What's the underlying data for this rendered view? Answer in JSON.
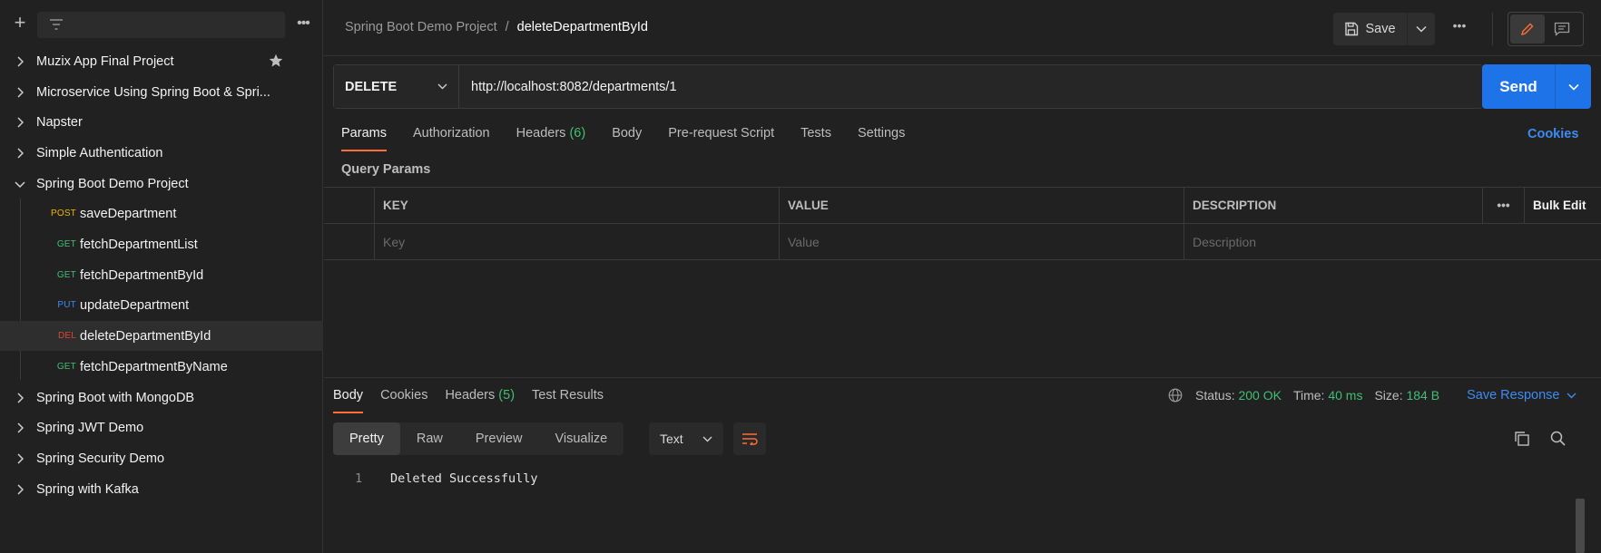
{
  "sidebar": {
    "collections": [
      {
        "label": "Muzix App Final Project",
        "expanded": false,
        "starred": true
      },
      {
        "label": "Microservice Using Spring Boot & Spri...",
        "expanded": false
      },
      {
        "label": "Napster",
        "expanded": false
      },
      {
        "label": "Simple Authentication",
        "expanded": false
      },
      {
        "label": "Spring Boot Demo Project",
        "expanded": true
      }
    ],
    "requests": [
      {
        "method": "POST",
        "name": "saveDepartment"
      },
      {
        "method": "GET",
        "name": "fetchDepartmentList"
      },
      {
        "method": "GET",
        "name": "fetchDepartmentById"
      },
      {
        "method": "PUT",
        "name": "updateDepartment"
      },
      {
        "method": "DEL",
        "name": "deleteDepartmentById",
        "selected": true
      },
      {
        "method": "GET",
        "name": "fetchDepartmentByName"
      }
    ],
    "collections_after": [
      {
        "label": "Spring Boot with MongoDB"
      },
      {
        "label": "Spring JWT Demo"
      },
      {
        "label": "Spring Security Demo"
      },
      {
        "label": "Spring with Kafka"
      }
    ]
  },
  "header": {
    "breadcrumb_parent": "Spring Boot Demo Project",
    "breadcrumb_sep": "/",
    "breadcrumb_current": "deleteDepartmentById",
    "save_label": "Save"
  },
  "request": {
    "method": "DELETE",
    "url": "http://localhost:8082/departments/1",
    "send_label": "Send"
  },
  "request_tabs": [
    {
      "label": "Params",
      "active": true
    },
    {
      "label": "Authorization"
    },
    {
      "label": "Headers",
      "count": "(6)"
    },
    {
      "label": "Body"
    },
    {
      "label": "Pre-request Script"
    },
    {
      "label": "Tests"
    },
    {
      "label": "Settings"
    }
  ],
  "cookies_label": "Cookies",
  "query_params": {
    "title": "Query Params",
    "headers": {
      "key": "KEY",
      "value": "VALUE",
      "description": "DESCRIPTION",
      "bulk_edit": "Bulk Edit"
    },
    "placeholders": {
      "key": "Key",
      "value": "Value",
      "description": "Description"
    }
  },
  "response_tabs": [
    {
      "label": "Body",
      "active": true
    },
    {
      "label": "Cookies"
    },
    {
      "label": "Headers",
      "count": "(5)"
    },
    {
      "label": "Test Results"
    }
  ],
  "response_status": {
    "status_label": "Status:",
    "status_value": "200 OK",
    "time_label": "Time:",
    "time_value": "40 ms",
    "size_label": "Size:",
    "size_value": "184 B",
    "save_response": "Save Response"
  },
  "format_tabs": [
    {
      "label": "Pretty",
      "active": true
    },
    {
      "label": "Raw"
    },
    {
      "label": "Preview"
    },
    {
      "label": "Visualize"
    }
  ],
  "response_type": "Text",
  "response_body": {
    "line_number": "1",
    "text": "Deleted Successfully"
  },
  "colors": {
    "accent": "#ff6c37",
    "send": "#1e73e8",
    "post": "#f0b400",
    "get": "#3fbf74",
    "put": "#3e8bf0",
    "delete": "#e2413a",
    "status_ok": "#3fbf74"
  }
}
